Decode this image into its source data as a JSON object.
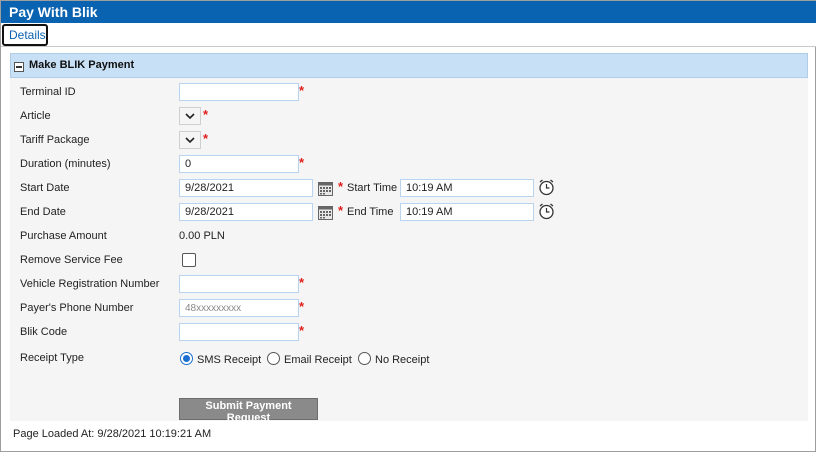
{
  "window": {
    "title": "Pay With Blik"
  },
  "tabs": [
    {
      "label": "Details"
    }
  ],
  "panel": {
    "title": "Make BLIK Payment"
  },
  "form": {
    "terminal_id": {
      "label": "Terminal ID",
      "value": ""
    },
    "article": {
      "label": "Article"
    },
    "tariff_package": {
      "label": "Tariff Package"
    },
    "duration": {
      "label": "Duration (minutes)",
      "value": "0"
    },
    "start_date": {
      "label": "Start Date",
      "value": "9/28/2021"
    },
    "start_time": {
      "label": "Start Time",
      "value": "10:19 AM"
    },
    "end_date": {
      "label": "End Date",
      "value": "9/28/2021"
    },
    "end_time": {
      "label": "End Time",
      "value": "10:19 AM"
    },
    "purchase_amount": {
      "label": "Purchase Amount",
      "value": "0.00 PLN"
    },
    "remove_service_fee": {
      "label": "Remove Service Fee",
      "checked": false
    },
    "vehicle_registration": {
      "label": "Vehicle Registration Number",
      "value": ""
    },
    "payer_phone": {
      "label": "Payer's Phone Number",
      "placeholder": "48xxxxxxxxx"
    },
    "blik_code": {
      "label": "Blik Code",
      "value": ""
    },
    "receipt_type": {
      "label": "Receipt Type",
      "options": [
        "SMS Receipt",
        "Email Receipt",
        "No Receipt"
      ],
      "selected": "SMS Receipt"
    },
    "required_marker": "*",
    "submit_label": "Submit Payment Request"
  },
  "footer": {
    "page_loaded": "Page Loaded At: 9/28/2021 10:19:21 AM"
  },
  "colors": {
    "titlebar": "#0a63b0",
    "panel_header": "#c8e0f6",
    "required": "#e02020",
    "radio_accent": "#1a6fd1"
  }
}
